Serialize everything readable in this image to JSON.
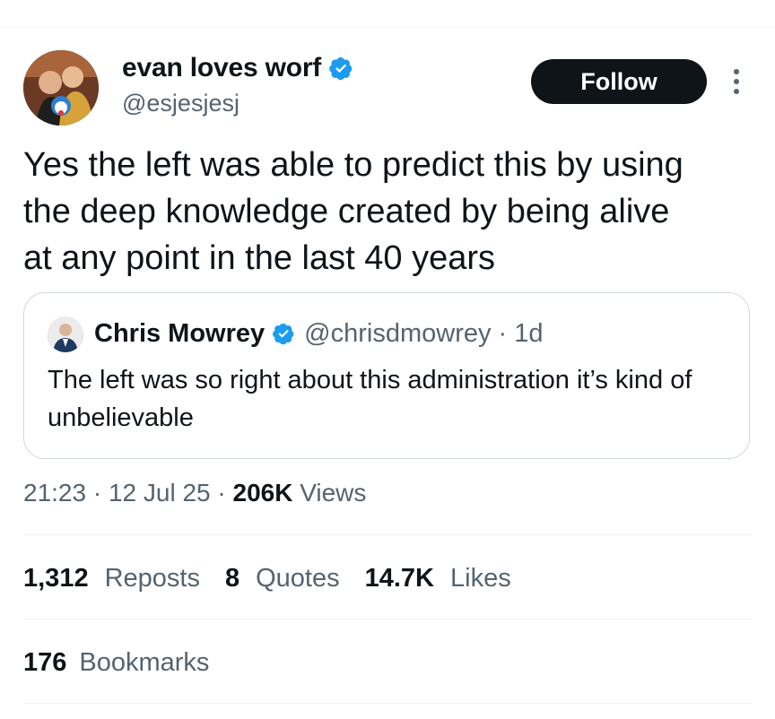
{
  "author": {
    "name": "evan loves worf",
    "handle": "@esjesjesj",
    "verified_color": "#1d9bf0"
  },
  "actions": {
    "follow_label": "Follow",
    "more_icon": "more-vertical-icon"
  },
  "tweet": {
    "text": "Yes the left was able to predict this by using\nthe deep knowledge created by being alive\nat any point in the last 40 years"
  },
  "quote": {
    "name": "Chris Mowrey",
    "handle_time": "@chrisdmowrey · 1d",
    "text": "The left was so right about this administration it’s kind of unbelievable"
  },
  "meta": {
    "time": "21:23",
    "date": "12 Jul 25",
    "views_count": "206K",
    "views_label": "Views"
  },
  "stats": {
    "reposts_count": "1,312",
    "reposts_label": "Reposts",
    "quotes_count": "8",
    "quotes_label": "Quotes",
    "likes_count": "14.7K",
    "likes_label": "Likes",
    "bookmarks_count": "176",
    "bookmarks_label": "Bookmarks"
  }
}
